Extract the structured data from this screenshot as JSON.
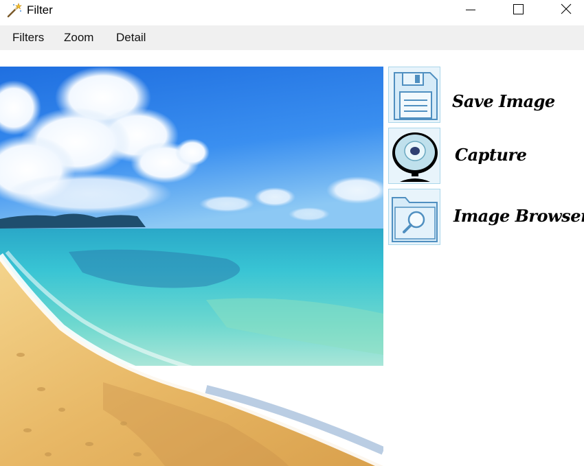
{
  "window": {
    "title": "Filter",
    "app_icon": "magic-wand-icon",
    "controls": [
      "minimize-icon",
      "maximize-icon",
      "close-icon"
    ]
  },
  "menu": {
    "items": [
      "Filters",
      "Zoom",
      "Detail"
    ]
  },
  "main": {
    "image": "beach-photo",
    "actions": [
      {
        "label": "Save Image",
        "icon": "floppy-disk-icon"
      },
      {
        "label": "Capture",
        "icon": "webcam-icon"
      },
      {
        "label": "Image Browser",
        "icon": "folder-search-icon"
      }
    ]
  },
  "colors": {
    "menu_bg": "#f0f0f0",
    "button_bg": "#e8f4fb",
    "button_border": "#a9d6ea",
    "icon_outline": "#5a9dc8"
  }
}
